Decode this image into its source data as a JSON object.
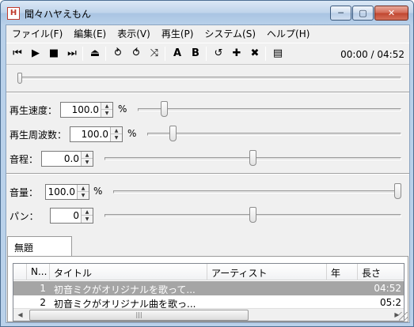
{
  "window": {
    "title": "聞々ハヤえもん",
    "app_icon": "H",
    "controls": {
      "minimize": "─",
      "maximize": "▢",
      "close": "✕"
    }
  },
  "menu": [
    "ファイル(F)",
    "編集(E)",
    "表示(V)",
    "再生(P)",
    "システム(S)",
    "ヘルプ(H)"
  ],
  "toolbar": {
    "buttons": [
      {
        "name": "previous-icon",
        "glyph": "⏮"
      },
      {
        "name": "play-icon",
        "glyph": "▶"
      },
      {
        "name": "stop-icon",
        "glyph": "■"
      },
      {
        "name": "next-icon",
        "glyph": "⏭"
      },
      {
        "name": "eject-icon",
        "glyph": "⏏"
      },
      {
        "name": "repeat-one-icon",
        "glyph": "⥁"
      },
      {
        "name": "repeat-all-icon",
        "glyph": "⥀"
      },
      {
        "name": "random-icon",
        "glyph": "⤨"
      },
      {
        "name": "ab-loop-a-icon",
        "glyph": "A"
      },
      {
        "name": "ab-loop-b-icon",
        "glyph": "B"
      },
      {
        "name": "mark-loop-icon",
        "glyph": "↺"
      },
      {
        "name": "add-marker-icon",
        "glyph": "✚"
      },
      {
        "name": "delete-marker-icon",
        "glyph": "✖"
      },
      {
        "name": "playlist-icon",
        "glyph": "▤"
      }
    ],
    "time": "00:00 / 04:52"
  },
  "position_slider": {
    "value": 0.0
  },
  "speed": {
    "label": "再生速度：",
    "value": "100.0",
    "unit": "%",
    "level": 0.09
  },
  "frequency": {
    "label": "再生周波数：",
    "value": "100.0",
    "unit": "%",
    "level": 0.09
  },
  "pitch": {
    "label": "音程：",
    "value": "0.0",
    "level": 0.5
  },
  "volume": {
    "label": "音量：",
    "value": "100.0",
    "unit": "%",
    "level": 1.0
  },
  "pan": {
    "label": "パン：",
    "value": "0",
    "level": 0.5
  },
  "tab": {
    "label": "無題"
  },
  "playlist": {
    "columns": [
      "N...",
      "タイトル",
      "アーティスト",
      "年",
      "長さ"
    ],
    "rows": [
      {
        "no": "1",
        "title": "初音ミクがオリジナルを歌って...",
        "artist": "",
        "year": "",
        "length": "04:52",
        "selected": true
      },
      {
        "no": "2",
        "title": "初音ミクがオリジナル曲を歌っ...",
        "artist": "",
        "year": "",
        "length": "05:2",
        "selected": false
      }
    ],
    "scroll": {
      "left": "◀",
      "right": "▶",
      "grip": "|||"
    }
  }
}
